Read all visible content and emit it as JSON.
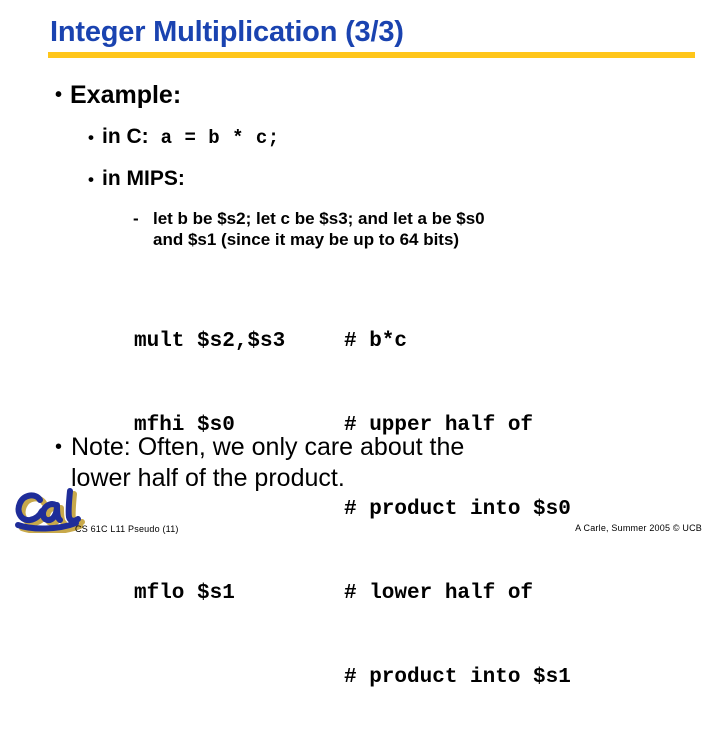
{
  "slide": {
    "title": "Integer Multiplication (3/3)",
    "title_color": "#1a43b0",
    "rule_color": "#ffc61a",
    "background": "#ffffff"
  },
  "bullets": {
    "example": {
      "marker": "•",
      "label": "Example:"
    },
    "in_c": {
      "marker": "•",
      "label": "in C:",
      "code": "a = b * c;"
    },
    "in_mips": {
      "marker": "•",
      "label": "in MIPS:"
    },
    "registers_note": {
      "marker": "-",
      "line1": "let b be $s2; let c be $s3; and let a be $s0",
      "line2": "and $s1 (since it may be up to 64 bits)"
    },
    "note": {
      "marker": "•",
      "line1": "Note: Often, we only care about the",
      "line2": "lower half of the product."
    }
  },
  "code": {
    "lines": [
      {
        "instruction": "mult $s2,$s3",
        "comment": "# b*c"
      },
      {
        "instruction": "mfhi $s0",
        "comment": "# upper half of"
      },
      {
        "instruction": "",
        "comment": "# product into $s0"
      },
      {
        "instruction": "mflo $s1",
        "comment": "# lower half of"
      },
      {
        "instruction": "",
        "comment": "# product into $s1"
      }
    ]
  },
  "logo": {
    "name": "cal-logo",
    "text": "Cal",
    "ink_color": "#1f2d99",
    "shadow_color": "#c8a94b"
  },
  "footer": {
    "left": "CS 61C L11 Pseudo (11)",
    "right": "A Carle, Summer 2005 © UCB"
  }
}
